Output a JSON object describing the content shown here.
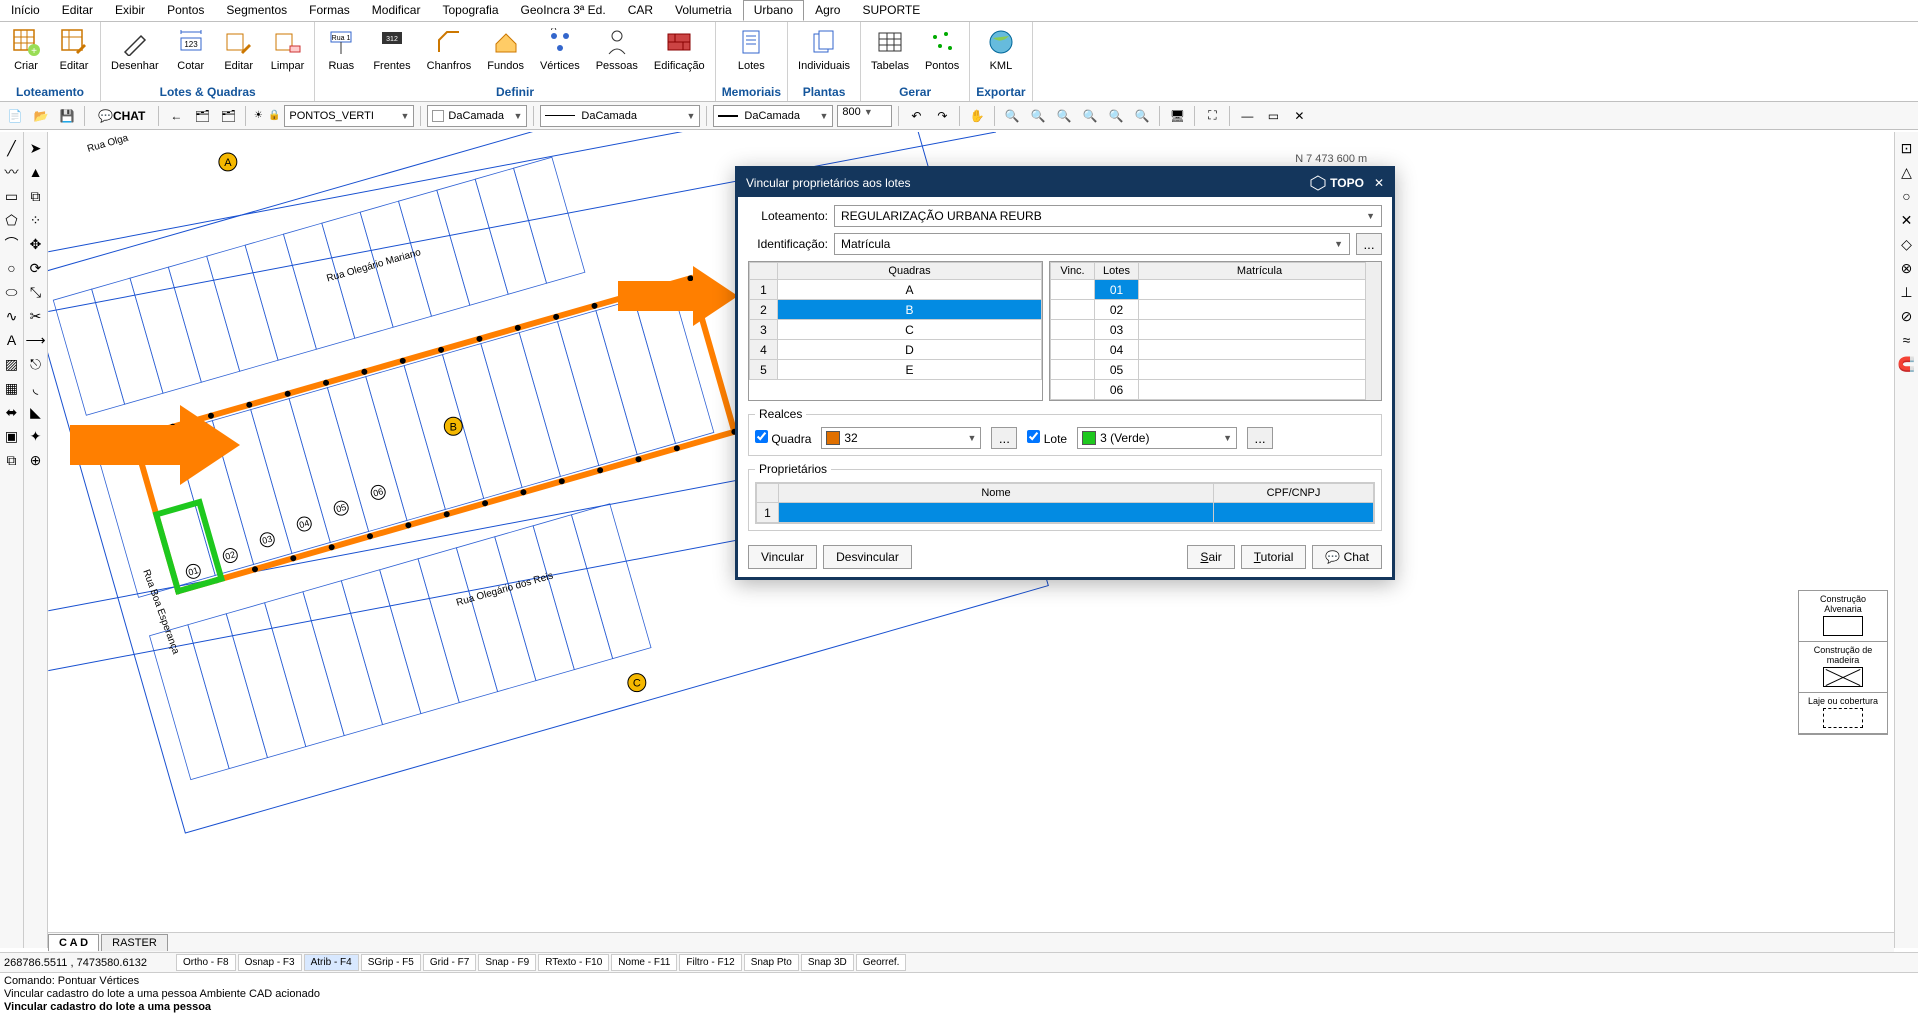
{
  "ribbon": {
    "tabs": [
      "Início",
      "Editar",
      "Exibir",
      "Pontos",
      "Segmentos",
      "Formas",
      "Modificar",
      "Topografia",
      "GeoIncra 3ª Ed.",
      "CAR",
      "Volumetria",
      "Urbano",
      "Agro",
      "SUPORTE"
    ],
    "active_tab": "Urbano",
    "groups": [
      {
        "label": "Loteamento",
        "buttons": [
          {
            "label": "Criar"
          },
          {
            "label": "Editar"
          }
        ]
      },
      {
        "label": "Lotes & Quadras",
        "buttons": [
          {
            "label": "Desenhar"
          },
          {
            "label": "Cotar"
          },
          {
            "label": "Editar"
          },
          {
            "label": "Limpar"
          }
        ]
      },
      {
        "label": "Definir",
        "buttons": [
          {
            "label": "Ruas"
          },
          {
            "label": "Frentes"
          },
          {
            "label": "Chanfros"
          },
          {
            "label": "Fundos"
          },
          {
            "label": "Vértices"
          },
          {
            "label": "Pessoas"
          },
          {
            "label": "Edificação"
          }
        ]
      },
      {
        "label": "Memoriais",
        "buttons": [
          {
            "label": "Lotes"
          }
        ]
      },
      {
        "label": "Plantas",
        "buttons": [
          {
            "label": "Individuais"
          }
        ]
      },
      {
        "label": "Gerar",
        "buttons": [
          {
            "label": "Tabelas"
          },
          {
            "label": "Pontos"
          }
        ]
      },
      {
        "label": "Exportar",
        "buttons": [
          {
            "label": "KML"
          }
        ]
      }
    ]
  },
  "quickbar": {
    "chat_label": "CHAT",
    "layer_dropdown": "PONTOS_VERTI",
    "dacamada1": "DaCamada",
    "dacamada2": "DaCamada",
    "dacamada3": "DaCamada",
    "scale": "800"
  },
  "dialog": {
    "title": "Vincular proprietários aos lotes",
    "brand": "TOPO",
    "loteamento_label": "Loteamento:",
    "loteamento_value": "REGULARIZAÇÃO URBANA REURB",
    "identificacao_label": "Identificação:",
    "identificacao_value": "Matrícula",
    "quadras_header": "Quadras",
    "quadras": [
      {
        "n": "1",
        "name": "A"
      },
      {
        "n": "2",
        "name": "B"
      },
      {
        "n": "3",
        "name": "C"
      },
      {
        "n": "4",
        "name": "D"
      },
      {
        "n": "5",
        "name": "E"
      }
    ],
    "selected_quadra_index": 1,
    "vinc_header": "Vinc.",
    "lotes_header": "Lotes",
    "matricula_header": "Matrícula",
    "lotes": [
      "01",
      "02",
      "03",
      "04",
      "05",
      "06"
    ],
    "selected_lote_index": 0,
    "realces_legend": "Realces",
    "quadra_check_label": "Quadra",
    "quadra_value": "32",
    "lote_check_label": "Lote",
    "lote_value": "3 (Verde)",
    "proprietarios_legend": "Proprietários",
    "prop_col_nome": "Nome",
    "prop_col_cpf": "CPF/CNPJ",
    "prop_rownum": "1",
    "btn_vincular": "Vincular",
    "btn_desvincular": "Desvincular",
    "btn_sair": "Sair",
    "btn_tutorial": "Tutorial",
    "btn_chat": "Chat"
  },
  "palette": {
    "row1": "Construção Alvenaria",
    "row2": "Construção de madeira",
    "row3": "Laje ou cobertura"
  },
  "tabs_bottom": {
    "cad": "C A D",
    "raster": "RASTER"
  },
  "status": {
    "coords": "268786.5511 , 7473580.6132",
    "snaps": [
      "Ortho - F8",
      "Osnap - F3",
      "Atrib - F4",
      "SGrip - F5",
      "Grid - F7",
      "Snap - F9",
      "RTexto - F10",
      "Nome - F11",
      "Filtro - F12",
      "Snap Pto",
      "Snap 3D",
      "Georref."
    ],
    "active_snap_index": 2
  },
  "cmd": {
    "line1": "Comando: Pontuar Vértices",
    "line2": "Vincular cadastro do lote a uma pessoa Ambiente CAD acionado",
    "line3": "Vincular cadastro do lote a uma pessoa"
  },
  "canvas": {
    "north_coord": "N 7 473 600 m",
    "streets": [
      "Rua Olegário Mariano",
      "Rua Boa Esperança",
      "Rua Olegário dos Reis",
      "Rua Olga"
    ]
  }
}
